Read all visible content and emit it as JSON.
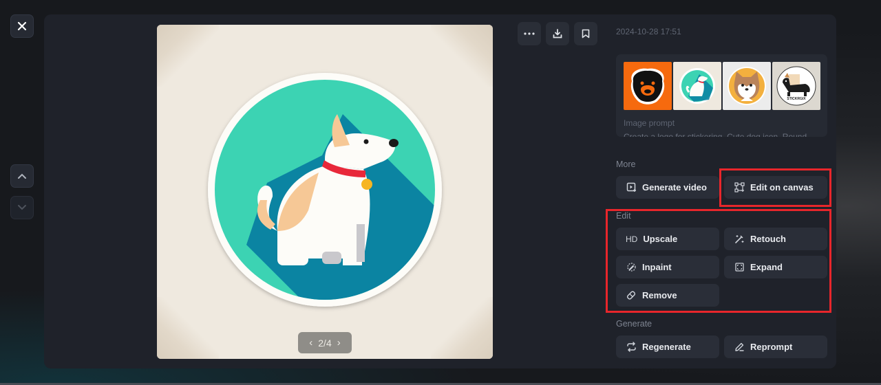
{
  "nav": {
    "close_icon": "close-icon",
    "prev_icon": "chevron-up-icon",
    "next_icon": "chevron-down-icon"
  },
  "viewer": {
    "image_alt": "Cute dog sticker logo in teal circle",
    "pager": {
      "current": 2,
      "total": 4,
      "label": "2/4"
    },
    "colors": {
      "teal": "#3cd3b3",
      "shadow": "#0b84a2",
      "collar": "#e8283a",
      "tag": "#f6b522",
      "patch": "#f6c896"
    }
  },
  "toolbar": {
    "more_icon": "more-icon",
    "download_icon": "download-icon",
    "bookmark_icon": "bookmark-icon"
  },
  "details": {
    "timestamp": "2024-10-28 17:51",
    "thumbnails": [
      {
        "name": "thumb-orange-dog",
        "selected": false
      },
      {
        "name": "thumb-teal-dog",
        "selected": true
      },
      {
        "name": "thumb-shiba",
        "selected": false
      },
      {
        "name": "thumb-stickergix",
        "selected": false,
        "caption": "STICKRGIX"
      }
    ],
    "prompt_label": "Image prompt",
    "prompt_text": "Create a logo for stickering. Cute dog icon. Round"
  },
  "sections": {
    "more": {
      "label": "More",
      "buttons": [
        {
          "label": "Generate video",
          "icon": "generate-video-icon"
        },
        {
          "label": "Edit on canvas",
          "icon": "edit-canvas-icon"
        }
      ]
    },
    "edit": {
      "label": "Edit",
      "buttons": [
        {
          "label": "Upscale",
          "icon_text": "HD"
        },
        {
          "label": "Retouch",
          "icon": "magic-wand-icon"
        },
        {
          "label": "Inpaint",
          "icon": "inpaint-brush-icon"
        },
        {
          "label": "Expand",
          "icon": "expand-icon"
        },
        {
          "label": "Remove",
          "icon": "eraser-icon"
        }
      ]
    },
    "generate": {
      "label": "Generate",
      "buttons": [
        {
          "label": "Regenerate",
          "icon": "regenerate-icon"
        },
        {
          "label": "Reprompt",
          "icon": "pencil-icon"
        }
      ]
    }
  },
  "annotations": {
    "highlight_color": "#e8262b"
  }
}
